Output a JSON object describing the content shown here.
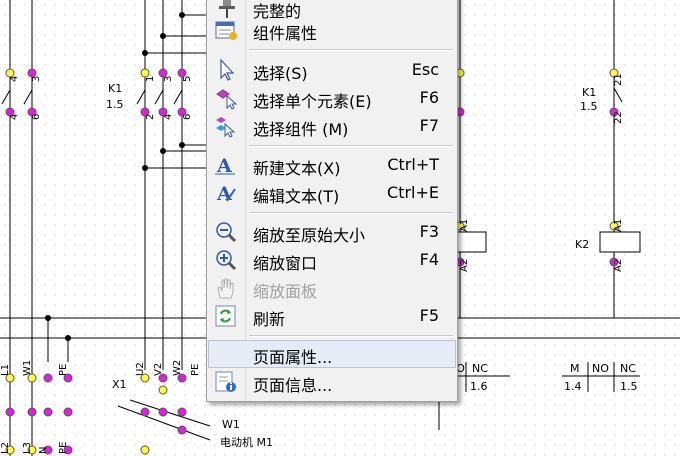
{
  "schematic": {
    "left_pins_top": [
      "4",
      "5",
      "6",
      "3"
    ],
    "center_pins_top": [
      "1",
      "3",
      "5"
    ],
    "center_pins_bottom": [
      "2",
      "4",
      "6"
    ],
    "left_contactor_label": "K1",
    "left_contactor_value": "1.5",
    "right_pin_top": "21",
    "right_pin_bottom": "22",
    "right_contactor_label": "K1",
    "right_contactor_value": "1.5",
    "coil_pin_top": "A1",
    "coil_pin_bottom": "A2",
    "coil2_label": "K2",
    "terminal_left_labels": [
      "L1",
      "W1"
    ],
    "terminal_x1_label": "X1",
    "terminal_center_labels": [
      "U2",
      "V2",
      "W2",
      "PE"
    ],
    "terminal_left_extra": [
      "PE"
    ],
    "bottom_left_labels": [
      "L2",
      "L3",
      "N",
      "PE"
    ],
    "motor_wire_label": "W1",
    "motor_label": "电动机 M1",
    "table1": {
      "headers": [
        "NO",
        "NC"
      ],
      "values": [
        "1.6"
      ]
    },
    "table2": {
      "headers": [
        "M",
        "NO",
        "NC"
      ],
      "values": [
        "1.4",
        "1.5"
      ]
    }
  },
  "menu": {
    "items": [
      {
        "key": "complete",
        "label": "完整的",
        "shortcut": "",
        "icon": "pin-icon",
        "disabled": false
      },
      {
        "key": "component-props",
        "label": "组件属性",
        "shortcut": "",
        "icon": "component-properties-icon",
        "disabled": false
      },
      {
        "key": "select",
        "label": "选择(S)",
        "shortcut": "Esc",
        "icon": "cursor-arrow-icon",
        "disabled": false
      },
      {
        "key": "select-single",
        "label": "选择单个元素(E)",
        "shortcut": "F6",
        "icon": "select-element-icon",
        "disabled": false
      },
      {
        "key": "select-component",
        "label": "选择组件 (M)",
        "shortcut": "F7",
        "icon": "select-component-icon",
        "disabled": false
      },
      {
        "key": "new-text",
        "label": "新建文本(X)",
        "shortcut": "Ctrl+T",
        "icon": "new-text-icon",
        "disabled": false
      },
      {
        "key": "edit-text",
        "label": "编辑文本(T)",
        "shortcut": "Ctrl+E",
        "icon": "edit-text-icon",
        "disabled": false
      },
      {
        "key": "zoom-original",
        "label": "缩放至原始大小",
        "shortcut": "F3",
        "icon": "zoom-out-icon",
        "disabled": false
      },
      {
        "key": "zoom-window",
        "label": "缩放窗口",
        "shortcut": "F4",
        "icon": "zoom-in-icon",
        "disabled": false
      },
      {
        "key": "zoom-panel",
        "label": "缩放面板",
        "shortcut": "",
        "icon": "hand-icon",
        "disabled": true
      },
      {
        "key": "refresh",
        "label": "刷新",
        "shortcut": "F5",
        "icon": "refresh-icon",
        "disabled": false
      },
      {
        "key": "page-props",
        "label": "页面属性...",
        "shortcut": "",
        "icon": "",
        "disabled": false,
        "highlighted": true
      },
      {
        "key": "page-info",
        "label": "页面信息...",
        "shortcut": "",
        "icon": "page-info-icon",
        "disabled": false
      }
    ]
  }
}
